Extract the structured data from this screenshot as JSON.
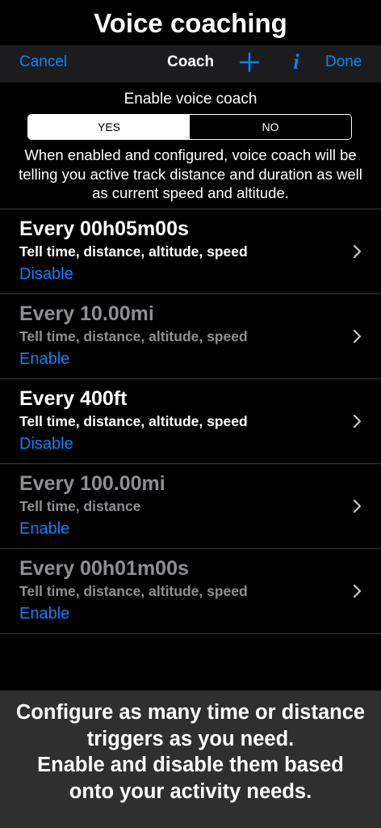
{
  "page": {
    "title": "Voice coaching"
  },
  "nav": {
    "cancel_label": "Cancel",
    "title": "Coach",
    "add_icon": "plus-icon",
    "info_icon": "info-icon",
    "info_glyph": "i",
    "done_label": "Done"
  },
  "voice_coach": {
    "enable_label": "Enable voice coach",
    "options": [
      "YES",
      "NO"
    ],
    "selected": "YES",
    "description": "When enabled and configured, voice coach will be telling you active track distance and duration as well as current speed and altitude."
  },
  "triggers": [
    {
      "title": "Every 00h05m00s",
      "subtitle": "Tell time, distance, altitude, speed",
      "action": "Disable",
      "enabled": true
    },
    {
      "title": "Every 10.00mi",
      "subtitle": "Tell time, distance, altitude, speed",
      "action": "Enable",
      "enabled": false
    },
    {
      "title": "Every 400ft",
      "subtitle": "Tell time, distance, altitude, speed",
      "action": "Disable",
      "enabled": true
    },
    {
      "title": "Every 100.00mi",
      "subtitle": "Tell time, distance",
      "action": "Enable",
      "enabled": false
    },
    {
      "title": "Every 00h01m00s",
      "subtitle": "Tell time, distance, altitude, speed",
      "action": "Enable",
      "enabled": false
    }
  ],
  "footer": {
    "lines": [
      "Configure as many time or distance",
      "triggers as you need.",
      "Enable and disable them based",
      "onto your activity needs."
    ]
  },
  "colors": {
    "accent": "#0a84ff",
    "background": "#000000",
    "navbar": "#1c1c1e",
    "disabled_text": "#8e8e93",
    "footer_bg": "#2f2f2f"
  }
}
